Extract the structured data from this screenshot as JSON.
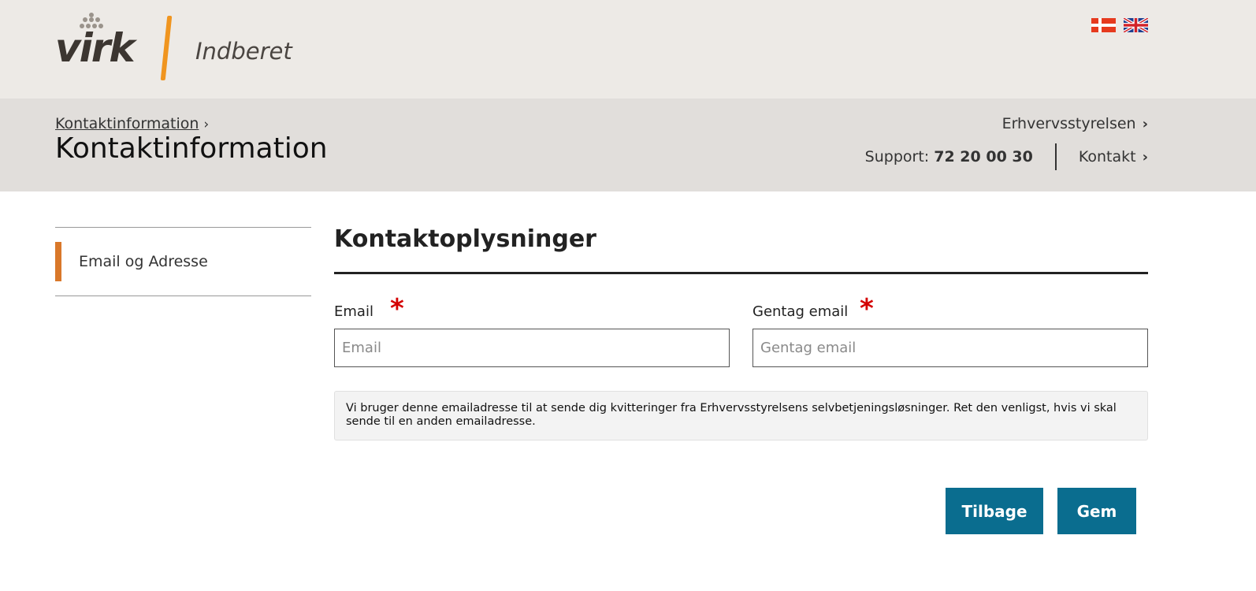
{
  "header": {
    "logo_text": "virk",
    "logo_product": "Indberet",
    "languages": [
      {
        "code": "da",
        "icon": "danish-flag-icon"
      },
      {
        "code": "en",
        "icon": "uk-flag-icon"
      }
    ]
  },
  "subheader": {
    "breadcrumb": [
      "Kontaktinformation"
    ],
    "title": "Kontaktinformation",
    "organization": "Erhvervsstyrelsen",
    "support_label": "Support:",
    "support_phone": "72 20 00 30",
    "contact_label": "Kontakt"
  },
  "sidebar": {
    "items": [
      {
        "label": "Email og Adresse",
        "active": true
      }
    ]
  },
  "main": {
    "section_title": "Kontaktoplysninger",
    "email": {
      "label": "Email",
      "placeholder": "Email",
      "value": "",
      "required": "*"
    },
    "repeat_email": {
      "label": "Gentag email",
      "placeholder": "Gentag email",
      "value": "",
      "required": "*"
    },
    "info_text": "Vi bruger denne emailadresse til at sende dig kvitteringer fra Erhvervsstyrelsens selvbetjeningsløsninger. Ret den venligst, hvis vi skal sende til en anden emailadresse.",
    "buttons": {
      "back": "Tilbage",
      "save": "Gem"
    }
  },
  "colors": {
    "accent_orange": "#f0951f",
    "active_marker": "#d9782a",
    "button_blue": "#0a6d8f",
    "required_red": "#d40000"
  }
}
